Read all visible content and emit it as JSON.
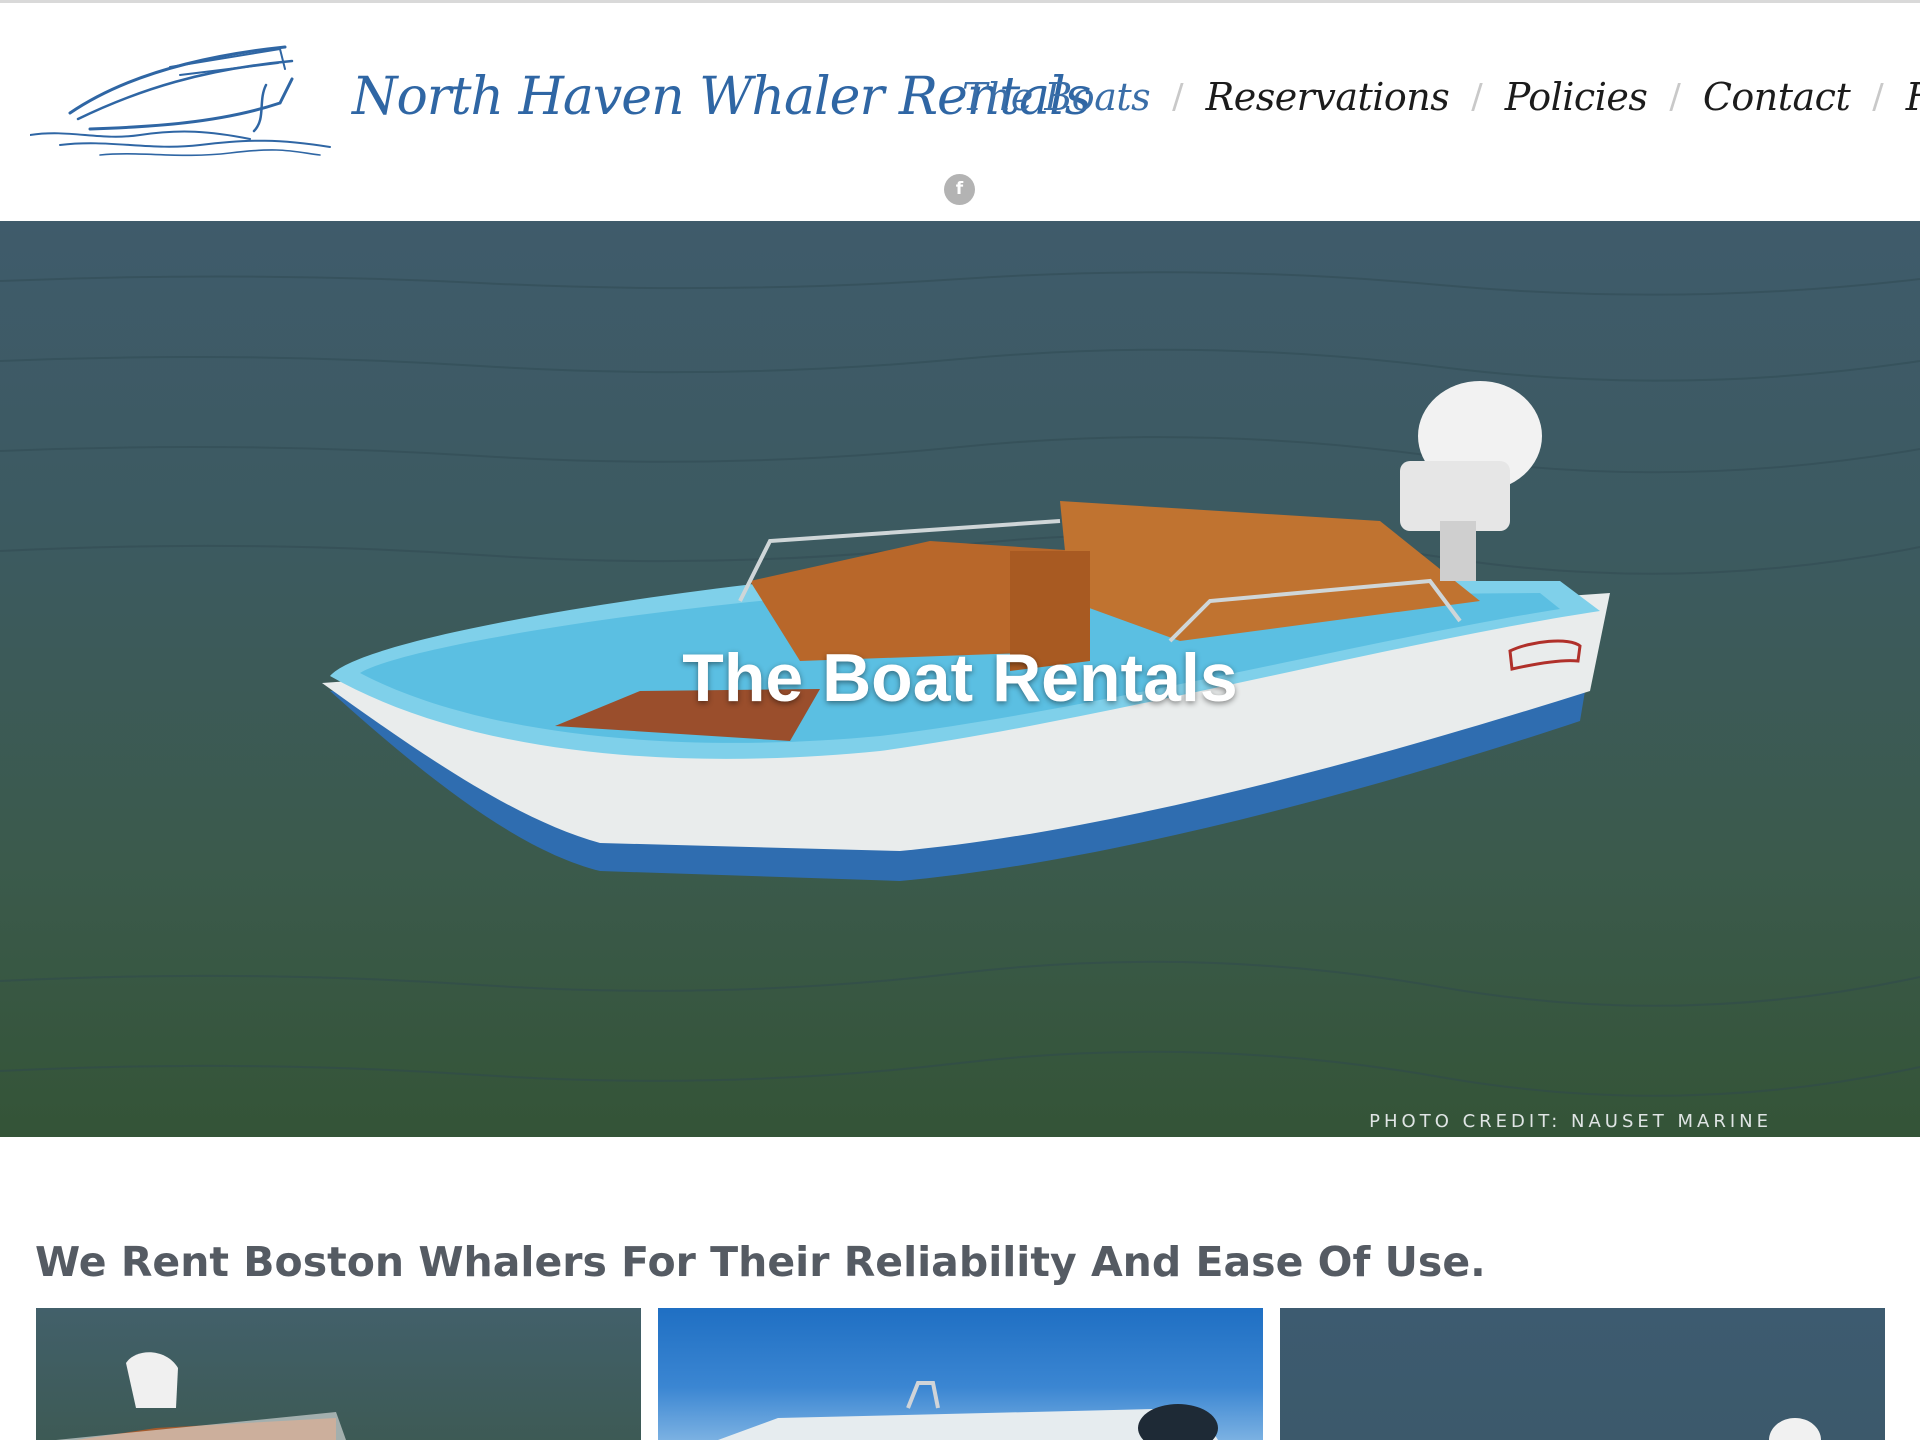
{
  "header": {
    "site_title": "North Haven Whaler Rentals",
    "logo_icon": "boat-logo-icon",
    "nav": [
      {
        "label": "The Boats",
        "active": true
      },
      {
        "label": "Reservations",
        "active": false
      },
      {
        "label": "Policies",
        "active": false
      },
      {
        "label": "Contact",
        "active": false
      },
      {
        "label": "FAQ",
        "active": false
      }
    ],
    "separator": "/",
    "social": {
      "icon": "facebook-icon",
      "glyph": "f"
    }
  },
  "hero": {
    "title": "The Boat Rentals",
    "photo_credit": "PHOTO CREDIT: NAUSET MARINE"
  },
  "content": {
    "heading": "We Rent Boston Whalers For Their Reliability And Ease Of Use."
  },
  "colors": {
    "brand_blue": "#2f66a4",
    "nav_active": "#3a6ea8",
    "heading_gray": "#555b63"
  }
}
